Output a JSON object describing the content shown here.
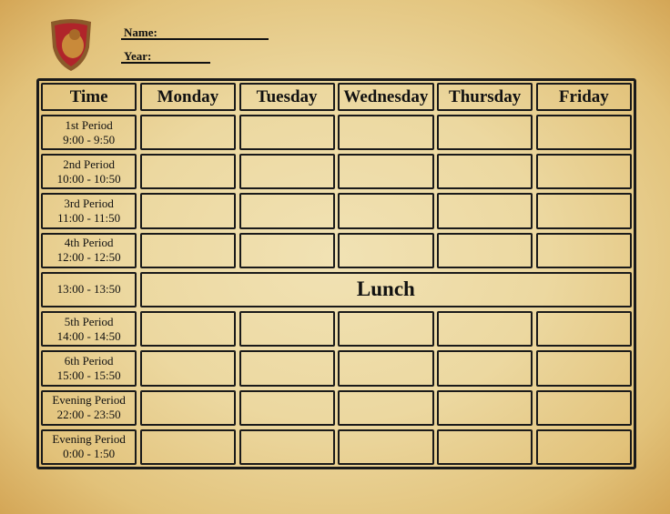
{
  "header": {
    "name_label": "Name:",
    "year_label": "Year:"
  },
  "columns": [
    "Time",
    "Monday",
    "Tuesday",
    "Wednesday",
    "Thursday",
    "Friday"
  ],
  "rows": [
    {
      "period": "1st Period",
      "time": "9:00 - 9:50"
    },
    {
      "period": "2nd Period",
      "time": "10:00 - 10:50"
    },
    {
      "period": "3rd Period",
      "time": "11:00 - 11:50"
    },
    {
      "period": "4th Period",
      "time": "12:00 - 12:50"
    },
    {
      "period": "",
      "time": "13:00 - 13:50",
      "label": "Lunch"
    },
    {
      "period": "5th Period",
      "time": "14:00 - 14:50"
    },
    {
      "period": "6th Period",
      "time": "15:00 - 15:50"
    },
    {
      "period": "Evening Period",
      "time": "22:00 - 23:50"
    },
    {
      "period": "Evening Period",
      "time": "0:00 - 1:50"
    }
  ],
  "crest_icon": "lion-crest"
}
